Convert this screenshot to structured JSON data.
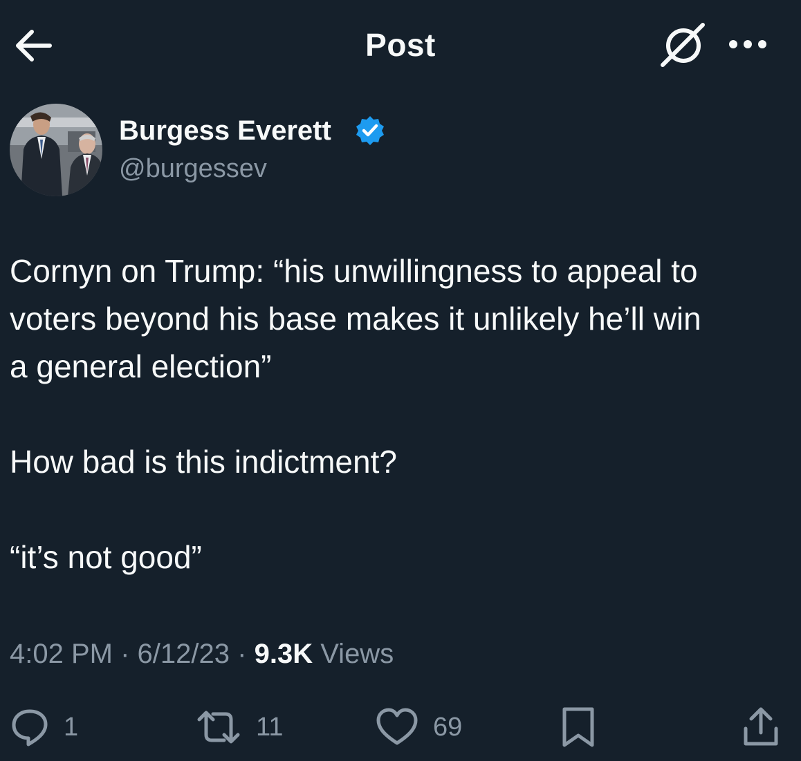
{
  "header": {
    "title": "Post",
    "back_icon": "arrow-left-icon",
    "grok_icon": "grok-icon",
    "more_icon": "more-horizontal-icon"
  },
  "author": {
    "display_name": "Burgess Everett",
    "handle": "@burgessev",
    "verified": true,
    "verified_color": "#1d9bf0"
  },
  "tweet": {
    "paragraphs": [
      "Cornyn on Trump: “his unwillingness to appeal to\nvoters beyond his base makes it unlikely he’ll win\na general election”",
      "How bad is this indictment?",
      "“it’s not good”"
    ]
  },
  "meta": {
    "time": "4:02 PM",
    "separator": "·",
    "date": "6/12/23",
    "views_count": "9.3K",
    "views_label": "Views"
  },
  "actions": {
    "replies": "1",
    "reposts": "11",
    "likes": "69",
    "reply_icon": "reply-icon",
    "repost_icon": "repost-icon",
    "like_icon": "heart-icon",
    "bookmark_icon": "bookmark-icon",
    "share_icon": "share-icon"
  },
  "colors": {
    "background": "#15202b",
    "text_primary": "#f7f9f9",
    "text_secondary": "#8b98a5",
    "accent": "#1d9bf0"
  }
}
